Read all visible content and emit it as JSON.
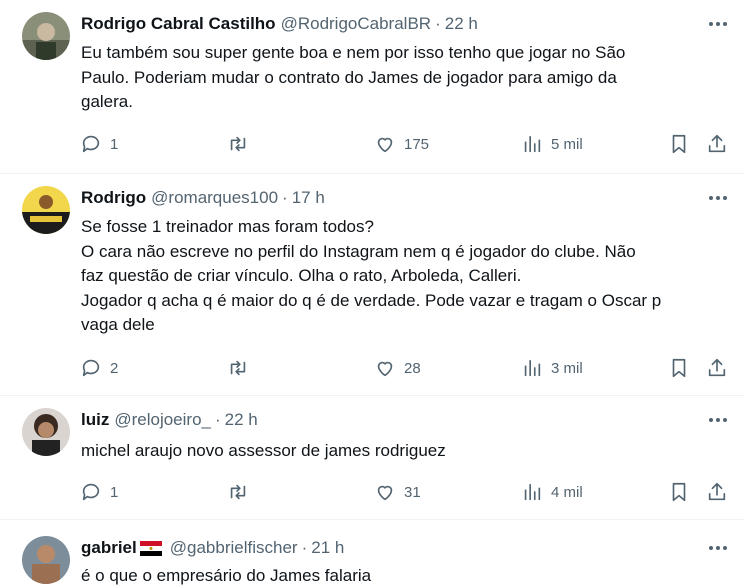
{
  "tweets": [
    {
      "name": "Rodrigo Cabral Castilho",
      "handle": "@RodrigoCabralBR",
      "time": "22 h",
      "text": [
        "Eu também sou super gente boa e nem por isso tenho que jogar no São",
        "Paulo. Poderiam mudar o contrato do James de jogador para amigo da",
        "galera."
      ],
      "replies": "1",
      "retweets": "",
      "likes": "175",
      "views": "5 mil"
    },
    {
      "name": "Rodrigo",
      "handle": "@romarques100",
      "time": "17 h",
      "text": [
        "Se fosse 1 treinador mas foram todos?",
        "O cara não escreve no perfil do Instagram nem q é jogador do clube. Não",
        "faz questão de criar vínculo. Olha o rato, Arboleda, Calleri.",
        "Jogador q acha q é maior do q é de verdade. Pode vazar e tragam o Oscar p",
        "vaga dele"
      ],
      "replies": "2",
      "retweets": "",
      "likes": "28",
      "views": "3 mil"
    },
    {
      "name": "luiz",
      "handle": "@relojoeiro_",
      "time": "22 h",
      "text": [
        "michel araujo novo assessor de james rodriguez"
      ],
      "replies": "1",
      "retweets": "",
      "likes": "31",
      "views": "4 mil"
    },
    {
      "name": "gabriel",
      "handle": "@gabbrielfischer",
      "time": "21 h",
      "text": [
        "é o que o empresário do James falaria"
      ],
      "flag_icon": "egypt-flag-emoji"
    }
  ],
  "separator": "·",
  "colors": {
    "text": "#0f1419",
    "secondary": "#536471",
    "divider": "#eff3f4"
  }
}
